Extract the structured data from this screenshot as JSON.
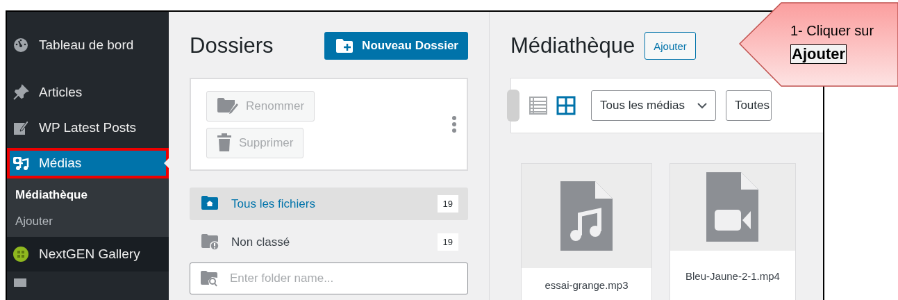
{
  "sidebar": {
    "items": [
      {
        "label": "Tableau de bord",
        "kind": "gauge",
        "selected": false,
        "highlighted": false
      },
      {
        "label": "Articles",
        "kind": "pin",
        "selected": false,
        "highlighted": false
      },
      {
        "label": "WP Latest Posts",
        "kind": "edit",
        "selected": false,
        "highlighted": false
      },
      {
        "label": "Médias",
        "kind": "media",
        "selected": true,
        "highlighted": true,
        "children": [
          {
            "label": "Médiathèque",
            "selected": true
          },
          {
            "label": "Ajouter",
            "selected": false
          }
        ]
      },
      {
        "label": "NextGEN Gallery",
        "kind": "gallery",
        "selected": false,
        "highlighted": false
      }
    ]
  },
  "folders": {
    "title": "Dossiers",
    "new_button": "Nouveau Dossier",
    "actions": [
      {
        "label": "Renommer",
        "kind": "rename",
        "disabled": true
      },
      {
        "label": "Supprimer",
        "kind": "trash",
        "disabled": true
      }
    ],
    "list": [
      {
        "label": "Tous les fichiers",
        "count": "19",
        "kind": "home",
        "selected": true
      },
      {
        "label": "Non classé",
        "count": "19",
        "kind": "alert",
        "selected": false
      }
    ],
    "search": {
      "placeholder": "Enter folder name..."
    }
  },
  "media": {
    "title": "Médiathèque",
    "add_button": "Ajouter",
    "view_modes": [
      {
        "kind": "list",
        "selected": false
      },
      {
        "kind": "grid",
        "selected": true
      }
    ],
    "filters": [
      {
        "label": "Tous les médias",
        "kind": "select"
      },
      {
        "label": "Toutes",
        "kind": "select"
      }
    ],
    "attachments": [
      {
        "kind": "audio",
        "filename": "essai-grange.mp3"
      },
      {
        "kind": "video",
        "filename": "Bleu-Jaune-2-1.mp4"
      }
    ]
  },
  "callout": {
    "text": "1- Cliquer sur",
    "emphasis": "Ajouter"
  }
}
